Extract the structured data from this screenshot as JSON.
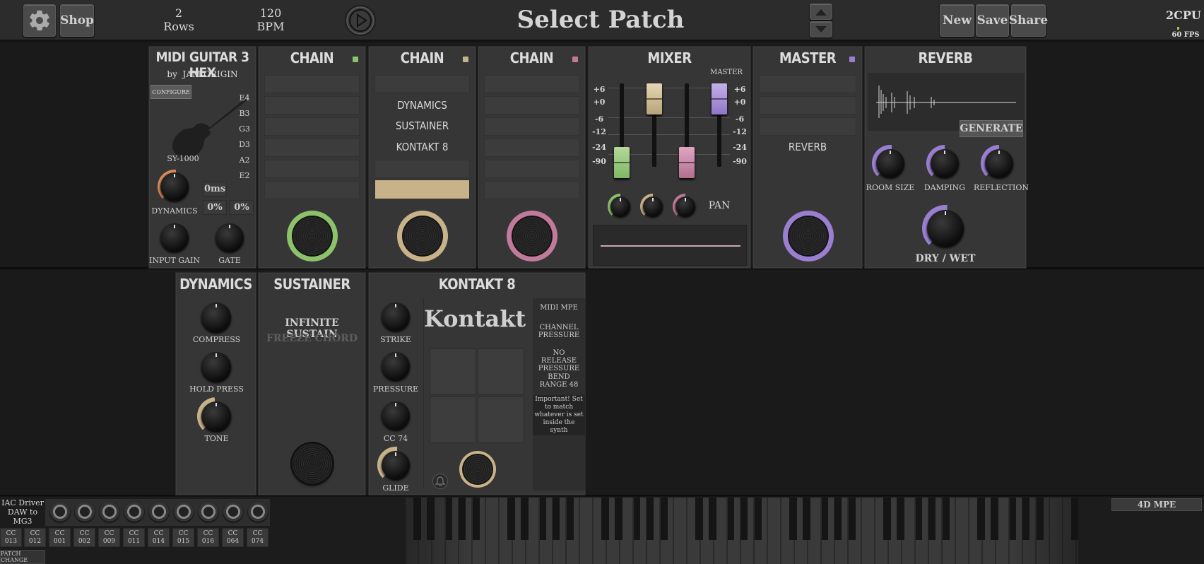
{
  "topbar": {
    "shop": "Shop",
    "rows_value": "2",
    "rows_label": "Rows",
    "bpm_value": "120",
    "bpm_label": "BPM",
    "title": "Select Patch",
    "new": "New",
    "save": "Save",
    "share": "Share",
    "cpu": "2CPU",
    "fps": "60 FPS"
  },
  "row1": {
    "guitar": {
      "title": "MIDI GUITAR 3 HEX",
      "by": "by",
      "brand": "JAM ORIGIN",
      "configure": "CONFIGURE",
      "model": "SY-1000",
      "strings": [
        "E4",
        "B3",
        "G3",
        "D3",
        "A2",
        "E2"
      ],
      "dynamics": "DYNAMICS",
      "ms": "0ms",
      "pct1": "0%",
      "pct2": "0%",
      "input_gain": "INPUT GAIN",
      "gate": "GATE"
    },
    "chain1": {
      "title": "CHAIN",
      "color": "#8dc26b"
    },
    "chain2": {
      "title": "CHAIN",
      "color": "#c8b28a",
      "items": [
        "DYNAMICS",
        "SUSTAINER",
        "KONTAKT 8"
      ]
    },
    "chain3": {
      "title": "CHAIN",
      "color": "#c17a9a"
    },
    "mixer": {
      "title": "MIXER",
      "master": "MASTER",
      "scale_left": [
        "+6",
        "+0",
        "-6",
        "-12",
        "-24",
        "-90"
      ],
      "scale_right": [
        "+6",
        "+0",
        "-6",
        "-12",
        "-24",
        "-90"
      ],
      "pan": "PAN"
    },
    "master": {
      "title": "MASTER",
      "color": "#9a7fd1",
      "item": "REVERB"
    },
    "reverb": {
      "title": "REVERB",
      "generate": "GENERATE",
      "knobs": [
        "ROOM SIZE",
        "DAMPING",
        "REFLECTION"
      ],
      "drywet": "DRY / WET"
    }
  },
  "row2": {
    "dynamics": {
      "title": "DYNAMICS",
      "knobs": [
        "COMPRESS",
        "HOLD PRESS",
        "TONE"
      ]
    },
    "sustainer": {
      "title": "SUSTAINER",
      "infinite": "INFINITE SUSTAIN",
      "freeze": "FREEZE CHORD"
    },
    "kontakt": {
      "title": "KONTAKT 8",
      "logo": "Kontakt",
      "knobs": [
        "STRIKE",
        "PRESSURE",
        "CC 74",
        "GLIDE"
      ],
      "midi_mpe": "MIDI MPE",
      "channel_pressure": "CHANNEL PRESSURE",
      "no_release": "NO RELEASE PRESSURE",
      "bend_range": "BEND RANGE 48",
      "important": "Important! Set to match whatever is set inside the synth"
    }
  },
  "bottom": {
    "driver": "IAC Driver DAW to MG3",
    "cc": [
      "CC 013",
      "CC 012",
      "CC 001",
      "CC 002",
      "CC 009",
      "CC 011",
      "CC 014",
      "CC 015",
      "CC 016",
      "CC 064",
      "CC 074"
    ],
    "patch_change": "PATCH CHANGE",
    "mpe": "4D MPE"
  }
}
